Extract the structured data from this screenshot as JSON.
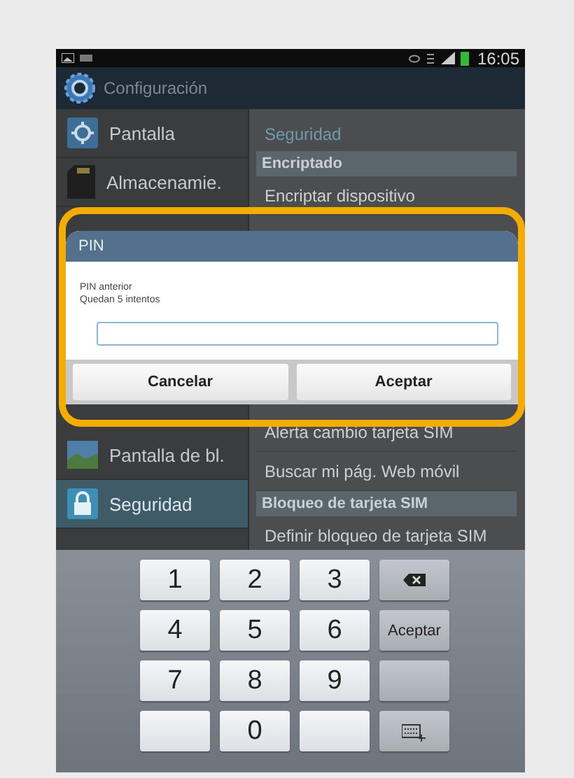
{
  "status_bar": {
    "time": "16:05"
  },
  "action_bar": {
    "title": "Configuración"
  },
  "sidebar": {
    "top_items": [
      {
        "label": "Pantalla",
        "selected": false
      },
      {
        "label": "Almacenamie.",
        "selected": false
      }
    ],
    "bottom_items": [
      {
        "label": "Pantalla de bl.",
        "selected": false
      },
      {
        "label": "Seguridad",
        "selected": true
      }
    ]
  },
  "detail": {
    "title": "Seguridad",
    "top_items": [
      {
        "kind": "section",
        "label": "Encriptado"
      },
      {
        "kind": "item",
        "label": "Encriptar dispositivo"
      }
    ],
    "bottom_items": [
      {
        "kind": "item",
        "label": "Alerta cambio tarjeta SIM"
      },
      {
        "kind": "item",
        "label": "Buscar mi pág. Web móvil"
      },
      {
        "kind": "section",
        "label": "Bloqueo de tarjeta SIM"
      },
      {
        "kind": "item",
        "label": "Definir bloqueo de tarjeta SIM"
      }
    ]
  },
  "dialog": {
    "title": "PIN",
    "message": [
      "PIN anterior",
      "Quedan 5 intentos"
    ],
    "buttons": [
      "Cancelar",
      "Aceptar"
    ]
  },
  "keyboard": {
    "rows": [
      [
        {
          "kind": "digit",
          "label": "1"
        },
        {
          "kind": "digit",
          "label": "2"
        },
        {
          "kind": "digit",
          "label": "3"
        },
        {
          "kind": "backspace"
        }
      ],
      [
        {
          "kind": "digit",
          "label": "4"
        },
        {
          "kind": "digit",
          "label": "5"
        },
        {
          "kind": "digit",
          "label": "6"
        },
        {
          "kind": "action",
          "label": "Aceptar"
        }
      ],
      [
        {
          "kind": "digit",
          "label": "7"
        },
        {
          "kind": "digit",
          "label": "8"
        },
        {
          "kind": "digit",
          "label": "9"
        },
        {
          "kind": "blank_action"
        }
      ],
      [
        {
          "kind": "blank"
        },
        {
          "kind": "digit",
          "label": "0"
        },
        {
          "kind": "blank"
        },
        {
          "kind": "settings"
        }
      ]
    ]
  }
}
